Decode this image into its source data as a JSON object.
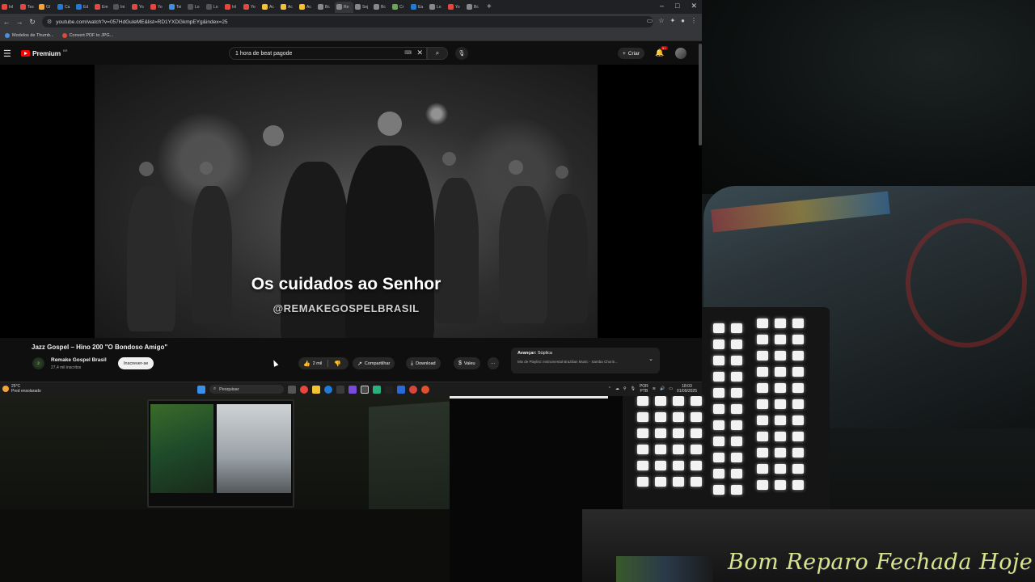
{
  "browser": {
    "tabs": [
      "Inl",
      "Tes",
      "Gl",
      "Ca",
      "Ed",
      "Em",
      "Ini",
      "Yo",
      "Yo",
      "Tei",
      "Lo",
      "Lo",
      "Inl",
      "Yo",
      "Ac",
      "Ac",
      "Ac",
      "Bc",
      "Re",
      "Sej",
      "Bc",
      "Cr",
      "Ea",
      "Lo",
      "Yo",
      "Bc"
    ],
    "active_tab_index": 18,
    "new_tab": "+",
    "window_controls": [
      "–",
      "□",
      "✕"
    ],
    "url": "youtube.com/watch?v=057HdGuleME&list=RD1YXDGkmpEYg&index=25",
    "bookmarks": [
      "Modelos de Thumb...",
      "Convert PDF to JPG..."
    ]
  },
  "youtube": {
    "brand": "Premium",
    "country_code": "BR",
    "search_query": "1 hora de beat pagode",
    "create_label": "Criar",
    "notifications_badge": "9+",
    "video": {
      "overlay_title": "Os cuidados ao Senhor",
      "overlay_handle": "@REMAKEGOSPELBRASIL",
      "heading": "Jazz Gospel – Hino 200 \"O Bondoso Amigo\"",
      "channel_name": "Remake Gospel Brasil",
      "channel_subs": "27,4 mil inscritos",
      "subscribe_label": "Inscrever-se",
      "likes": "2 mil",
      "share_label": "Compartilhar",
      "download_label": "Download",
      "thanks_label": "Valeu",
      "more_label": "···"
    },
    "playlist": {
      "next_prefix": "Avançar:",
      "next_title": "Súplica",
      "subtitle": "Mix de Playlist: Instrumental Brazilian Music - Samba Chorin..."
    }
  },
  "taskbar": {
    "weather_temp": "25°C",
    "weather_desc": "Pred ensolarado",
    "search_label": "Pesquisar",
    "lang_top": "POR",
    "lang_bottom": "PTB",
    "time": "18:03",
    "date": "01/09/2025"
  },
  "stream_overlay": {
    "text": "Bom Reparo Fechada Hoje"
  },
  "colors": {
    "youtube_red": "#ff0000",
    "overlay_text": "#d6e48a"
  }
}
